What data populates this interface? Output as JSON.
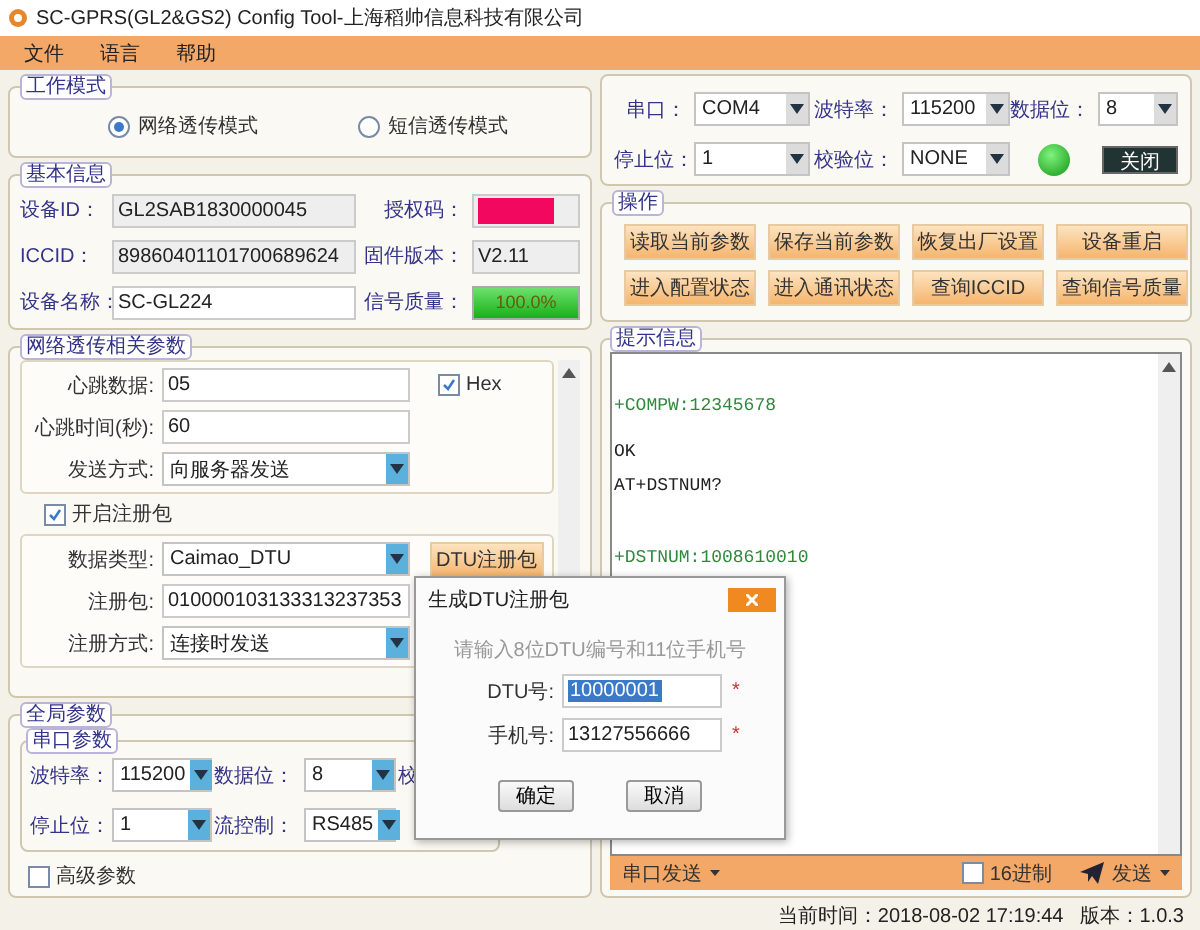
{
  "window": {
    "title": "SC-GPRS(GL2&GS2)  Config  Tool-上海稻帅信息科技有限公司"
  },
  "menu": [
    "文件",
    "语言",
    "帮助"
  ],
  "work_mode": {
    "title": "工作模式",
    "options": [
      {
        "label": "网络透传模式",
        "selected": true
      },
      {
        "label": "短信透传模式",
        "selected": false
      }
    ]
  },
  "basic_info": {
    "title": "基本信息",
    "fields": [
      {
        "label": "设备ID：",
        "kind": "readonly",
        "value": "GL2SAB1830000045"
      },
      {
        "label": "授权码：",
        "kind": "redacted"
      },
      {
        "label": "ICCID：",
        "kind": "readonly",
        "value": "89860401101700689624"
      },
      {
        "label": "固件版本：",
        "kind": "readonly",
        "value": "V2.11"
      },
      {
        "label": "设备名称：",
        "kind": "input",
        "value": "SC-GL224"
      },
      {
        "label": "信号质量：",
        "kind": "meter",
        "level": 1,
        "reading": "100.0%"
      }
    ]
  },
  "net_params": {
    "title": "网络透传相关参数",
    "heartbeat_data": {
      "label": "心跳数据:",
      "value": "05"
    },
    "hex": {
      "label": "Hex",
      "checked": true
    },
    "heartbeat_time": {
      "label": "心跳时间(秒):",
      "value": "60"
    },
    "send_mode": {
      "label": "发送方式:",
      "value": "向服务器发送"
    },
    "register": {
      "label": "开启注册包",
      "checked": true
    },
    "data_type": {
      "label": "数据类型:",
      "value": "Caimao_DTU"
    },
    "dtu_button": "DTU注册包",
    "packet": {
      "label": "注册包:",
      "value": "010000103133313237353"
    },
    "register_mode": {
      "label": "注册方式:",
      "value": "连接时发送"
    }
  },
  "global_params": {
    "title": "全局参数",
    "serial_title": "串口参数",
    "fields": [
      {
        "label": "波特率：",
        "value": "115200"
      },
      {
        "label": "数据位：",
        "value": "8"
      },
      {
        "label": "停止位：",
        "value": "1"
      },
      {
        "label": "流控制：",
        "value": "RS485"
      }
    ],
    "cut_label": "校",
    "advanced": {
      "label": "高级参数",
      "checked": false
    }
  },
  "serial": {
    "fields": [
      {
        "label": "串口：",
        "value": "COM4"
      },
      {
        "label": "波特率：",
        "value": "115200"
      },
      {
        "label": "数据位：",
        "value": "8"
      },
      {
        "label": "停止位：",
        "value": "1"
      },
      {
        "label": "校验位：",
        "value": "NONE"
      }
    ],
    "connected": true,
    "button": "关闭"
  },
  "operations": {
    "title": "操作",
    "buttons": [
      "读取当前参数",
      "保存当前参数",
      "恢复出厂设置",
      "设备重启",
      "进入配置状态",
      "进入通讯状态",
      "查询ICCID",
      "查询信号质量"
    ]
  },
  "log": {
    "title": "提示信息",
    "lines": [
      {
        "text": "+COMPW:12345678",
        "kind": "response"
      },
      {
        "text": "OK",
        "kind": "command"
      },
      {
        "text": "AT+DSTNUM?",
        "kind": "command"
      },
      {
        "text": "+DSTNUM:1008610010",
        "kind": "response"
      }
    ]
  },
  "send_bar": {
    "mode": "串口发送",
    "hex": {
      "label": "16进制",
      "checked": false
    },
    "send": "发送"
  },
  "status_bar": {
    "time": "当前时间：2018-08-02 17:19:44",
    "version": "版本：1.0.3"
  },
  "dialog": {
    "title": "生成DTU注册包",
    "hint": "请输入8位DTU编号和11位手机号",
    "fields": [
      {
        "label": "DTU号:",
        "value": "10000001",
        "selected": true,
        "mark": "*"
      },
      {
        "label": "手机号:",
        "value": "13127556666",
        "selected": false,
        "mark": "*"
      }
    ],
    "buttons": [
      "确定",
      "取消"
    ]
  }
}
